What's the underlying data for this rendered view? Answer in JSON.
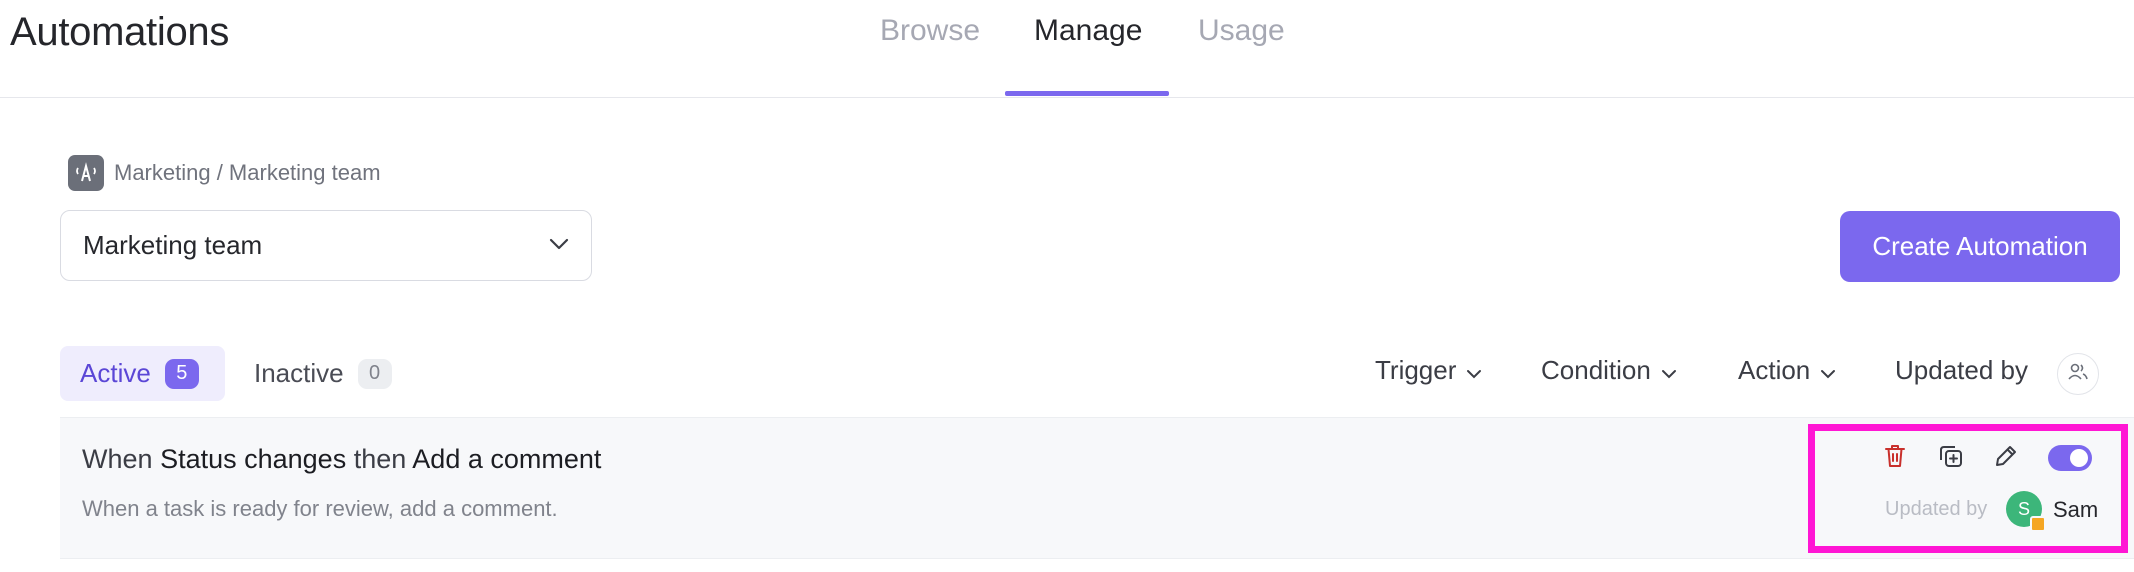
{
  "header": {
    "title": "Automations",
    "tabs": [
      {
        "label": "Browse",
        "active": false
      },
      {
        "label": "Manage",
        "active": true
      },
      {
        "label": "Usage",
        "active": false
      }
    ]
  },
  "breadcrumb": {
    "text": "Marketing / Marketing team",
    "icon": "team-avatar-icon"
  },
  "team_select": {
    "value": "Marketing team"
  },
  "create_button": {
    "label": "Create Automation"
  },
  "status_tabs": {
    "active": {
      "label": "Active",
      "count": "5"
    },
    "inactive": {
      "label": "Inactive",
      "count": "0"
    }
  },
  "filters": {
    "trigger": "Trigger",
    "condition": "Condition",
    "action": "Action",
    "updated_by": "Updated by"
  },
  "automations": [
    {
      "when": "When",
      "trigger": "Status changes",
      "then": "then",
      "action": "Add a comment",
      "description": "When a task is ready for review, add a comment.",
      "enabled": true,
      "updated_by_label": "Updated by",
      "user_initial": "S",
      "user_name": "Sam"
    }
  ],
  "colors": {
    "accent": "#7b68ee",
    "highlight_box": "#ff16d4",
    "delete": "#c9302c",
    "avatar": "#3cb67a"
  }
}
